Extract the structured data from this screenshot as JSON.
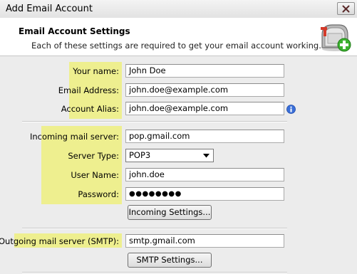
{
  "window": {
    "title": "Add Email Account"
  },
  "header": {
    "title": "Email Account Settings",
    "description": "Each of these settings are required to get your email account working."
  },
  "account": {
    "name_label": "Your name:",
    "name_value": "John Doe",
    "email_label": "Email Address:",
    "email_value": "john.doe@example.com",
    "alias_label": "Account Alias:",
    "alias_value": "john.doe@example.com"
  },
  "incoming": {
    "server_label": "Incoming mail server:",
    "server_value": "pop.gmail.com",
    "type_label": "Server Type:",
    "type_value": "POP3",
    "username_label": "User Name:",
    "username_value": "john.doe",
    "password_label": "Password:",
    "password_value": "●●●●●●●●",
    "settings_button": "Incoming Settings..."
  },
  "outgoing": {
    "server_label": "Outgoing mail server (SMTP):",
    "server_value": "smtp.gmail.com",
    "settings_button": "SMTP Settings..."
  },
  "colors": {
    "highlight": "#eeef8f",
    "info_icon": "#3a6fd8",
    "mailbox_flag": "#d43a2a",
    "plus_green": "#3bb12f"
  },
  "icons": [
    "close-icon",
    "mailbox-icon",
    "info-icon",
    "dropdown-arrow-icon"
  ]
}
